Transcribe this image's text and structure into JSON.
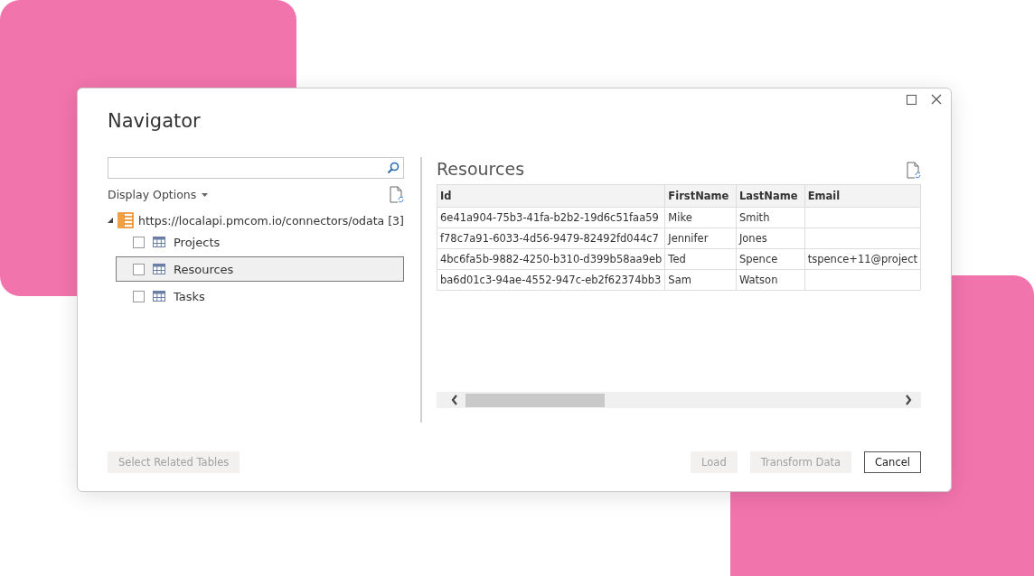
{
  "window": {
    "title": "Navigator"
  },
  "display_options": {
    "label": "Display Options"
  },
  "tree": {
    "label": "https://localapi.pmcom.io/connectors/odata [3]",
    "expanded": true,
    "children": [
      {
        "label": "Projects",
        "checked": false,
        "selected": false
      },
      {
        "label": "Resources",
        "checked": false,
        "selected": true
      },
      {
        "label": "Tasks",
        "checked": false,
        "selected": false
      }
    ]
  },
  "preview": {
    "title": "Resources",
    "columns": [
      "Id",
      "FirstName",
      "LastName",
      "Email"
    ],
    "rows": [
      [
        "6e41a904-75b3-41fa-b2b2-19d6c51faa59",
        "Mike",
        "Smith",
        ""
      ],
      [
        "f78c7a91-6033-4d56-9479-82492fd044c7",
        "Jennifer",
        "Jones",
        ""
      ],
      [
        "4bc6fa5b-9882-4250-b310-d399b58aa9eb",
        "Ted",
        "Spence",
        "tspence+11@project"
      ],
      [
        "ba6d01c3-94ae-4552-947c-eb2f62374bb3",
        "Sam",
        "Watson",
        ""
      ]
    ]
  },
  "buttons": [
    {
      "label": "Select Related Tables",
      "disabled": true
    },
    {
      "label": "Load",
      "disabled": true
    },
    {
      "label": "Transform Data",
      "disabled": true
    },
    {
      "label": "Cancel",
      "disabled": false
    }
  ]
}
